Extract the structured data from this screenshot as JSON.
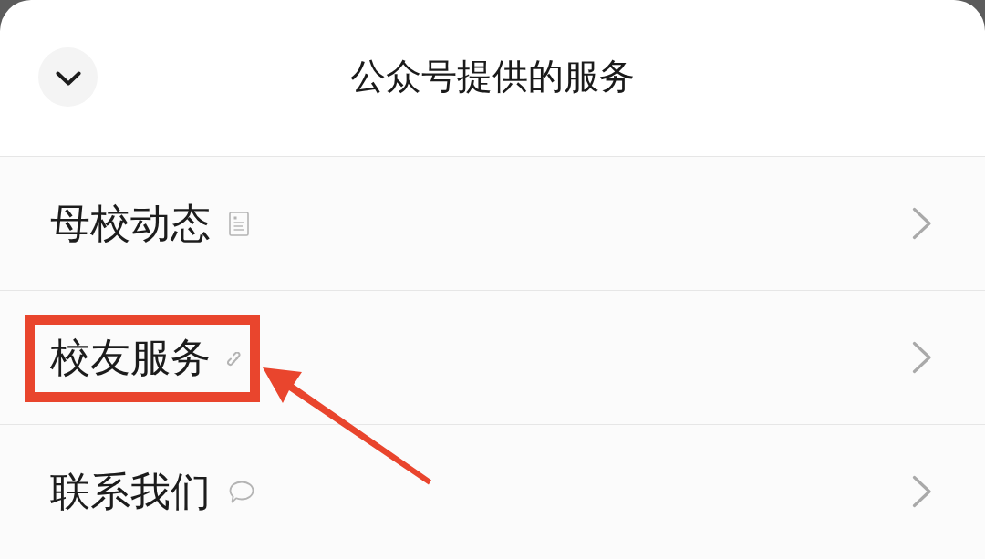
{
  "sheet": {
    "title": "公众号提供的服务"
  },
  "services": [
    {
      "label": "母校动态",
      "kind": "article",
      "highlighted": false
    },
    {
      "label": "校友服务",
      "kind": "link",
      "highlighted": true
    },
    {
      "label": "联系我们",
      "kind": "message",
      "highlighted": false
    }
  ]
}
